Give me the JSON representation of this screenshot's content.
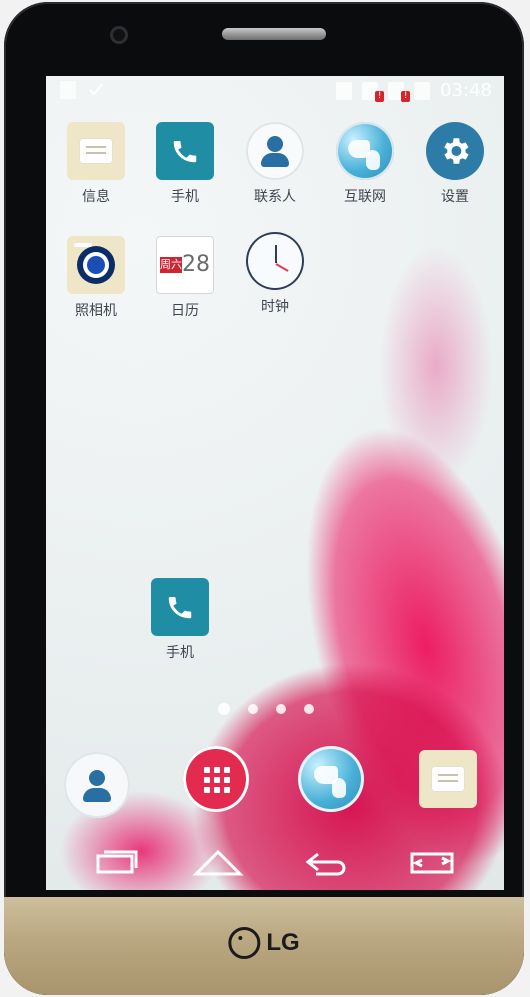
{
  "status_bar": {
    "time": "03:48"
  },
  "apps": {
    "row1": [
      {
        "label": "信息",
        "icon": "messages-icon"
      },
      {
        "label": "手机",
        "icon": "phone-icon"
      },
      {
        "label": "联系人",
        "icon": "contacts-icon"
      },
      {
        "label": "互联网",
        "icon": "browser-icon"
      },
      {
        "label": "设置",
        "icon": "settings-icon"
      }
    ],
    "row2": [
      {
        "label": "照相机",
        "icon": "camera-icon"
      },
      {
        "label": "日历",
        "icon": "calendar-icon",
        "day": "周六",
        "date": "28"
      },
      {
        "label": "时钟",
        "icon": "clock-icon"
      }
    ],
    "shortcut": {
      "label": "手机",
      "icon": "phone-icon"
    }
  },
  "pager": {
    "pages": 4,
    "current": 0
  },
  "brand": {
    "name": "LG"
  },
  "colors": {
    "accent_pink": "#e8196b",
    "phone_teal": "#1f8ea4",
    "settings_blue": "#2d7ca8",
    "calendar_red": "#d02433"
  }
}
